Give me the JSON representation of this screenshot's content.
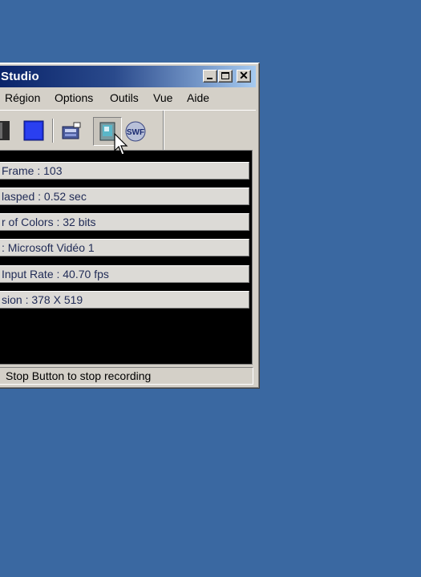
{
  "window": {
    "title": "Studio",
    "controls": {
      "minimize": "_",
      "maximize": "□",
      "close": "✕"
    }
  },
  "menu": {
    "items": [
      "Région",
      "Options",
      "Outils",
      "Vue",
      "Aide"
    ]
  },
  "toolbar": {
    "buttons": [
      "stop-icon",
      "record-region-icon",
      "annotate-icon",
      "camera-icon",
      "swf-icon"
    ],
    "swf_label": "SWF"
  },
  "info": {
    "rows": [
      "Frame : 103",
      "lasped  : 0.52 sec",
      "r of Colors  : 32 bits",
      " : Microsoft Vidéo 1",
      "Input Rate  : 40.70 fps",
      "sion  : 378 X 519"
    ]
  },
  "status": {
    "text": "Stop Button to stop recording"
  },
  "colors": {
    "desktop": "#3a68a1",
    "title_start": "#0a246a",
    "title_end": "#a6caf0",
    "face": "#d4d0c8",
    "info_text": "#1f2a55"
  }
}
